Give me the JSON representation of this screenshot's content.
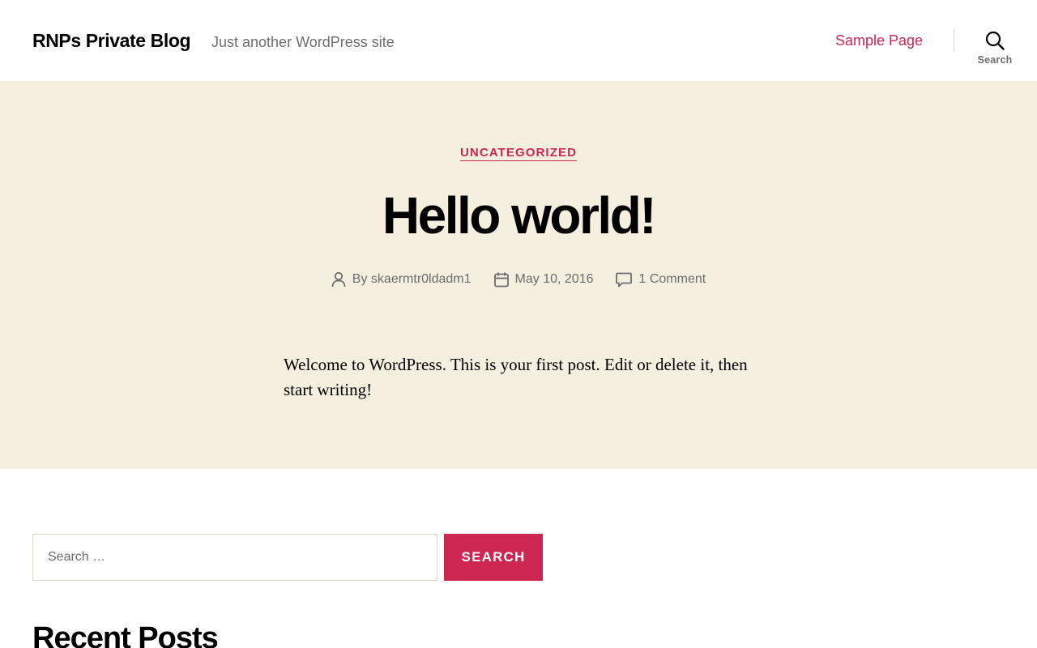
{
  "header": {
    "site_title": "RNPs Private Blog",
    "site_description": "Just another WordPress site",
    "nav_items": [
      {
        "label": "Sample Page"
      }
    ],
    "search_toggle_label": "Search"
  },
  "post": {
    "category": "Uncategorized",
    "title": "Hello world!",
    "author_prefix": "By",
    "author": "skaermtr0ldadm1",
    "date": "May 10, 2016",
    "comments": "1 Comment",
    "content": "Welcome to WordPress. This is your first post. Edit or delete it, then start writing!"
  },
  "search_form": {
    "placeholder": "Search …",
    "value": "",
    "submit_label": "Search"
  },
  "widgets": {
    "recent_posts_title": "Recent Posts"
  },
  "colors": {
    "accent": "#cd2653",
    "hero_background": "#f5efe0",
    "secondary_text": "#6d6d6d"
  },
  "icons": {
    "search_toggle": "search-icon",
    "author": "person-icon",
    "date": "calendar-icon",
    "comments": "comment-icon"
  }
}
